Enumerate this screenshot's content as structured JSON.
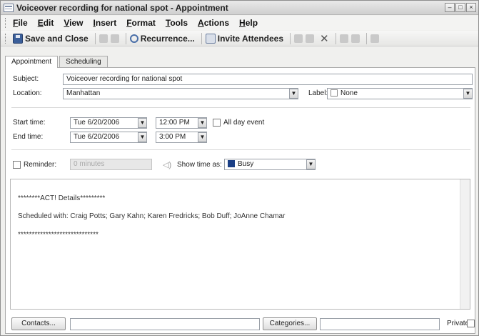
{
  "window": {
    "title": "Voiceover recording for national spot - Appointment"
  },
  "menu": [
    "File",
    "Edit",
    "View",
    "Insert",
    "Format",
    "Tools",
    "Actions",
    "Help"
  ],
  "toolbar": {
    "save_close": "Save and Close",
    "recurrence": "Recurrence...",
    "invite": "Invite Attendees"
  },
  "tabs": [
    "Appointment",
    "Scheduling"
  ],
  "form": {
    "subject_label": "Subject:",
    "subject_value": "Voiceover recording for national spot",
    "location_label": "Location:",
    "location_value": "Manhattan",
    "label_label": "Label:",
    "label_value": "None",
    "start_label": "Start time:",
    "start_date": "Tue 6/20/2006",
    "start_time": "12:00 PM",
    "all_day_label": "All day event",
    "end_label": "End time:",
    "end_date": "Tue 6/20/2006",
    "end_time": "3:00 PM",
    "reminder_label": "Reminder:",
    "reminder_value": "0 minutes",
    "show_time_label": "Show time as:",
    "show_time_value": "Busy"
  },
  "notes": {
    "line1": "********ACT! Details*********",
    "line2": "Scheduled with:  Craig Potts; Gary Kahn; Karen Fredricks; Bob Duff; JoAnne Chamar",
    "line3": "*****************************"
  },
  "footer": {
    "contacts_button": "Contacts...",
    "categories_button": "Categories...",
    "private_label": "Private"
  },
  "colors": {
    "busy": "#1a3f86"
  }
}
